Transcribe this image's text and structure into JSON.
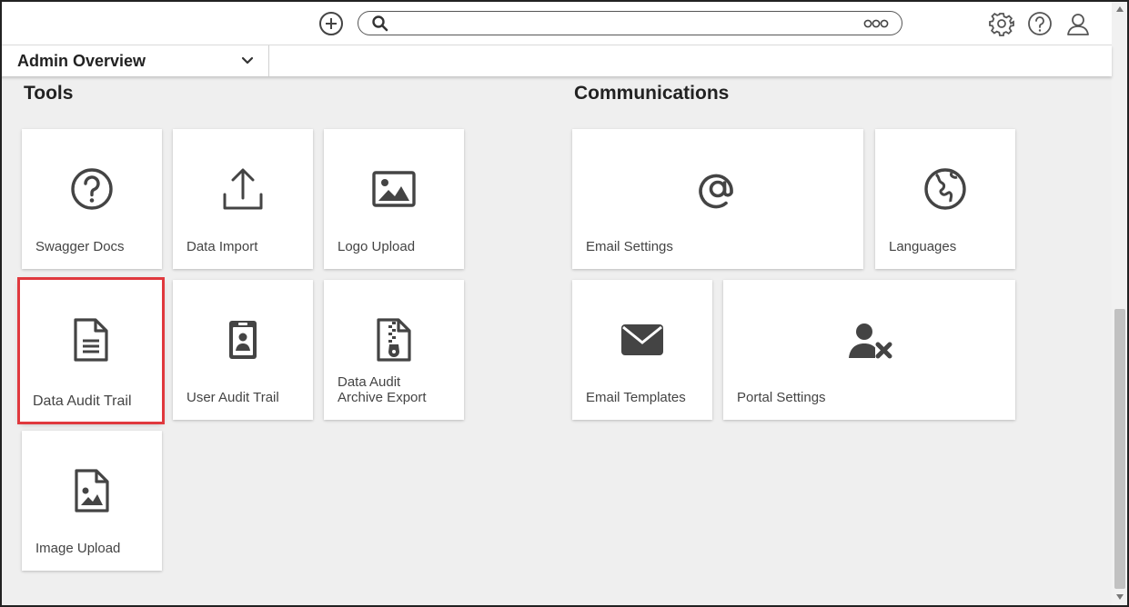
{
  "search": {
    "placeholder": ""
  },
  "header": {
    "dashboard_label": "Admin Overview"
  },
  "icons": {
    "add": "plus-circle-icon",
    "search": "search-icon",
    "more": "more-options-icon",
    "settings": "gear-icon",
    "help": "help-icon",
    "user": "user-icon"
  },
  "sections": {
    "tools": {
      "title": "Tools"
    },
    "communications": {
      "title": "Communications"
    }
  },
  "tiles": {
    "swagger_docs": {
      "label": "Swagger Docs",
      "icon": "question-circle-icon"
    },
    "data_import": {
      "label": "Data Import",
      "icon": "upload-icon"
    },
    "logo_upload": {
      "label": "Logo Upload",
      "icon": "image-icon"
    },
    "data_audit_trail": {
      "label": "Data Audit Trail",
      "icon": "document-icon"
    },
    "user_audit_trail": {
      "label": "User Audit Trail",
      "icon": "id-badge-icon"
    },
    "data_audit_archive_export": {
      "label": "Data Audit Archive Export",
      "icon": "zip-file-icon"
    },
    "image_upload": {
      "label": "Image Upload",
      "icon": "image-file-icon"
    },
    "email_settings": {
      "label": "Email Settings",
      "icon": "at-sign-icon"
    },
    "languages": {
      "label": "Languages",
      "icon": "globe-icon"
    },
    "email_templates": {
      "label": "Email Templates",
      "icon": "envelope-icon"
    },
    "portal_settings": {
      "label": "Portal Settings",
      "icon": "user-remove-icon"
    }
  },
  "colors": {
    "highlight": "#e0393e",
    "icon": "#444444",
    "background": "#efefef"
  }
}
